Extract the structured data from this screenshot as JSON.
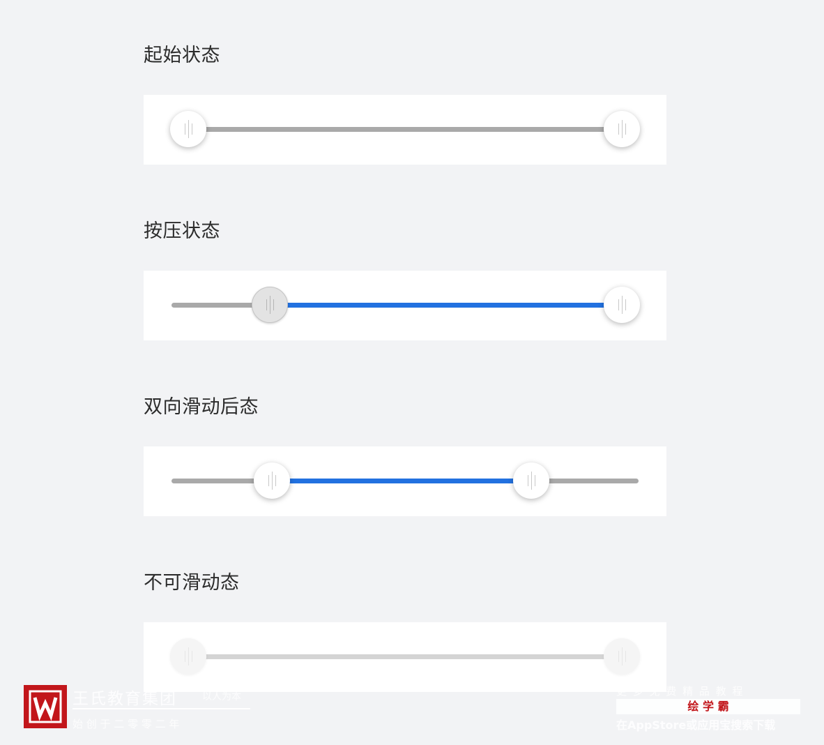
{
  "sections": [
    {
      "title": "起始状态"
    },
    {
      "title": "按压状态"
    },
    {
      "title": "双向滑动后态"
    },
    {
      "title": "不可滑动态"
    }
  ],
  "sliders": [
    {
      "state": "initial",
      "lower": 0.0,
      "upper": 1.0
    },
    {
      "state": "pressed",
      "lower": 0.21,
      "upper": 1.0,
      "pressed_thumb": "lower"
    },
    {
      "state": "dragged",
      "lower": 0.215,
      "upper": 0.77
    },
    {
      "state": "disabled",
      "lower": 0.0,
      "upper": 1.0
    }
  ],
  "colors": {
    "background": "#f2f3f5",
    "card": "#ffffff",
    "track_inactive": "#a9a9a9",
    "track_active": "#2271e0",
    "track_disabled": "#d4d4d4"
  },
  "watermark": {
    "brand": "王氏教育集团",
    "motto": "以人为本",
    "founded": "始 创 于 二 零 零 二 年",
    "promo_top": "更 多 免 费 精 品 教 程",
    "promo_brand": "绘 学 霸",
    "promo_bottom": "在AppStore或应用宝搜索下载"
  }
}
